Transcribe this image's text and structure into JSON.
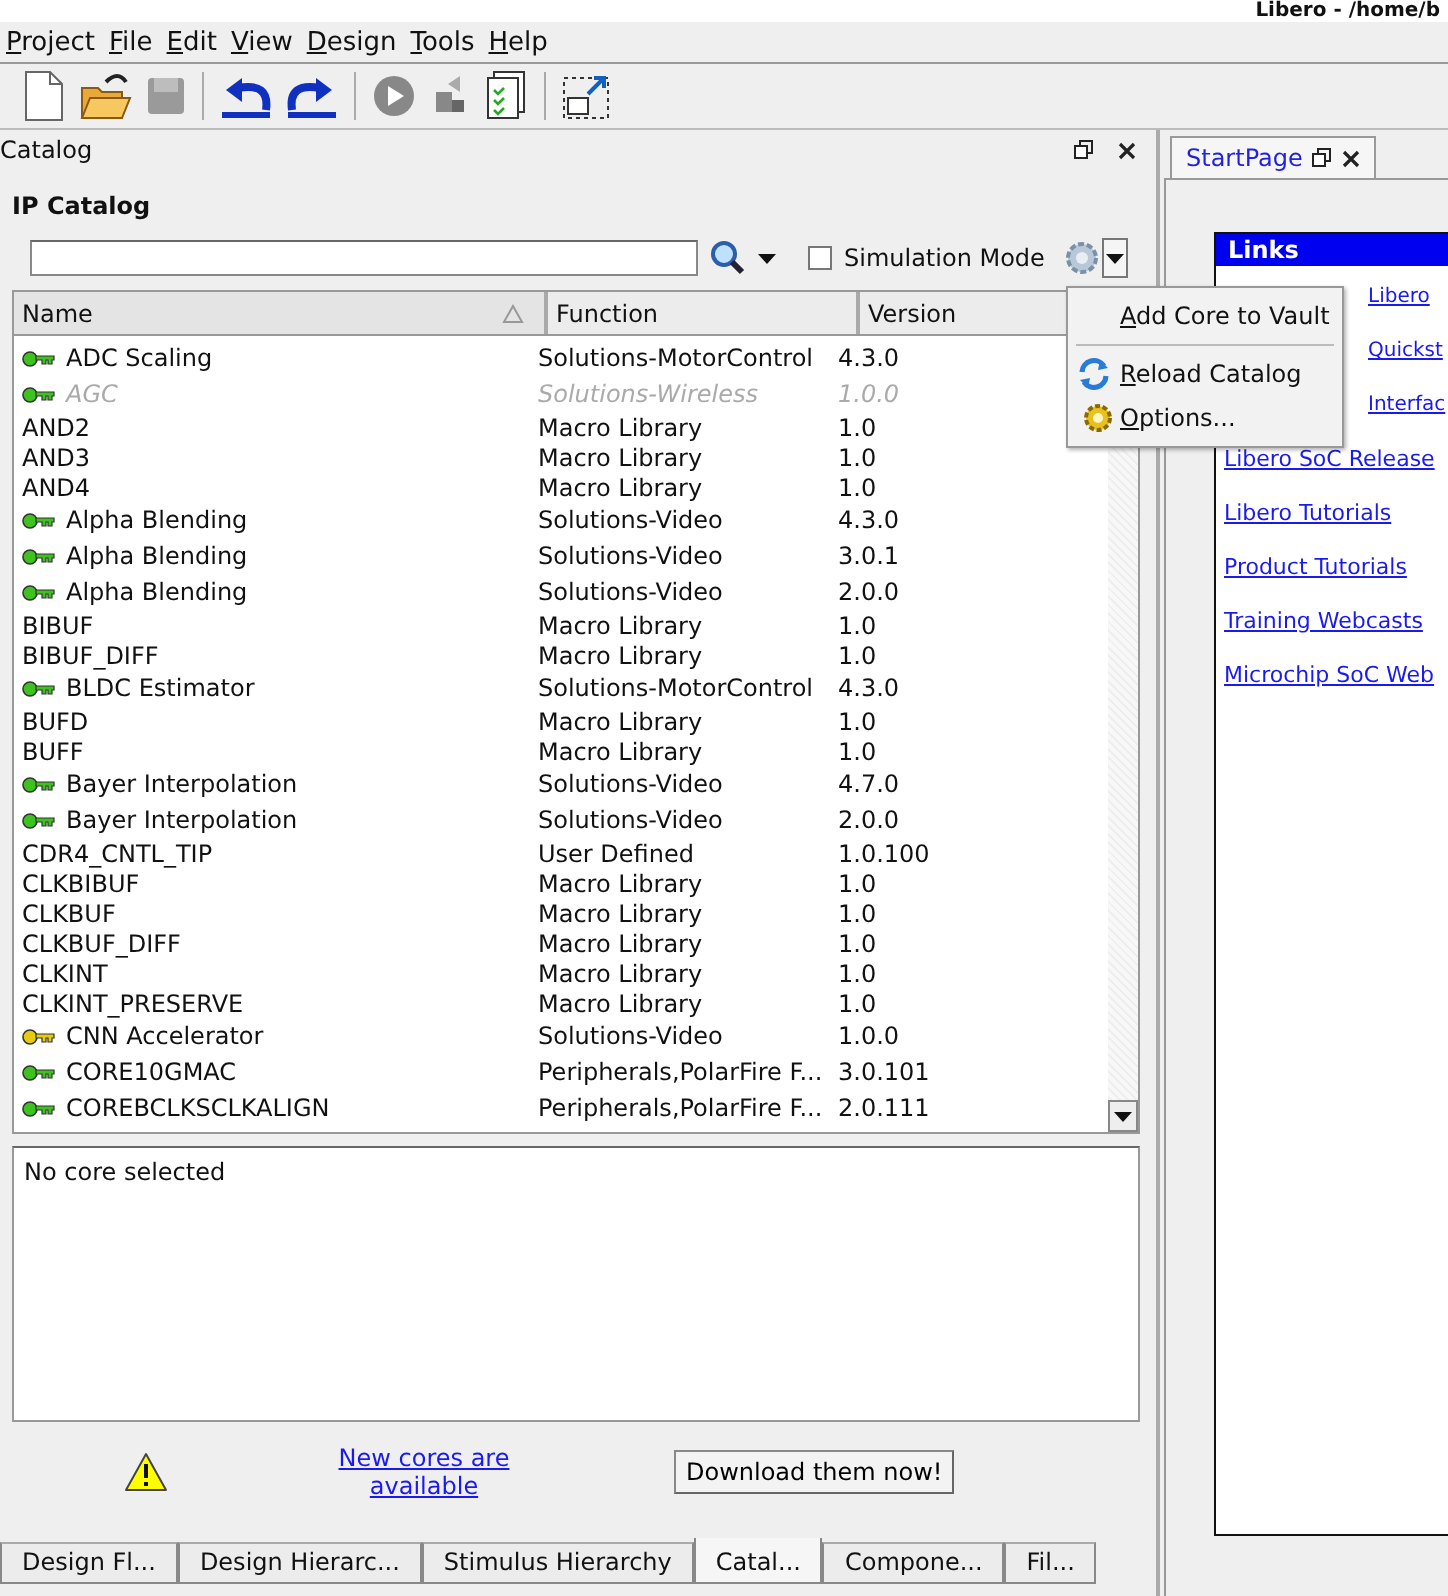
{
  "window": {
    "title": "Libero - /home/b"
  },
  "menubar": [
    "Project",
    "File",
    "Edit",
    "View",
    "Design",
    "Tools",
    "Help"
  ],
  "catalog_panel": {
    "title": "Catalog",
    "heading": "IP Catalog",
    "simulation_mode": {
      "label": "Simulation Mode",
      "checked": false
    },
    "table": {
      "columns": [
        {
          "label": "Name",
          "sorted": true
        },
        {
          "label": "Function",
          "sorted": false
        },
        {
          "label": "Version",
          "sorted": false
        }
      ],
      "rows": [
        {
          "name": "ADC Scaling",
          "function": "Solutions-MotorControl",
          "version": "4.3.0",
          "kind": "licensed",
          "disabled": false
        },
        {
          "name": "AGC",
          "function": "Solutions-Wireless",
          "version": "1.0.0",
          "kind": "licensed",
          "disabled": true
        },
        {
          "name": "AND2",
          "function": "Macro Library",
          "version": "1.0",
          "kind": "plain",
          "disabled": false
        },
        {
          "name": "AND3",
          "function": "Macro Library",
          "version": "1.0",
          "kind": "plain",
          "disabled": false
        },
        {
          "name": "AND4",
          "function": "Macro Library",
          "version": "1.0",
          "kind": "plain",
          "disabled": false
        },
        {
          "name": "Alpha Blending",
          "function": "Solutions-Video",
          "version": "4.3.0",
          "kind": "licensed",
          "disabled": false
        },
        {
          "name": "Alpha Blending",
          "function": "Solutions-Video",
          "version": "3.0.1",
          "kind": "licensed",
          "disabled": false
        },
        {
          "name": "Alpha Blending",
          "function": "Solutions-Video",
          "version": "2.0.0",
          "kind": "licensed",
          "disabled": false
        },
        {
          "name": "BIBUF",
          "function": "Macro Library",
          "version": "1.0",
          "kind": "plain",
          "disabled": false
        },
        {
          "name": "BIBUF_DIFF",
          "function": "Macro Library",
          "version": "1.0",
          "kind": "plain",
          "disabled": false
        },
        {
          "name": "BLDC Estimator",
          "function": "Solutions-MotorControl",
          "version": "4.3.0",
          "kind": "licensed",
          "disabled": false
        },
        {
          "name": "BUFD",
          "function": "Macro Library",
          "version": "1.0",
          "kind": "plain",
          "disabled": false
        },
        {
          "name": "BUFF",
          "function": "Macro Library",
          "version": "1.0",
          "kind": "plain",
          "disabled": false
        },
        {
          "name": "Bayer Interpolation",
          "function": "Solutions-Video",
          "version": "4.7.0",
          "kind": "licensed",
          "disabled": false
        },
        {
          "name": "Bayer Interpolation",
          "function": "Solutions-Video",
          "version": "2.0.0",
          "kind": "licensed",
          "disabled": false
        },
        {
          "name": "CDR4_CNTL_TIP",
          "function": "User Defined",
          "version": "1.0.100",
          "kind": "plain",
          "disabled": false
        },
        {
          "name": "CLKBIBUF",
          "function": "Macro Library",
          "version": "1.0",
          "kind": "plain",
          "disabled": false
        },
        {
          "name": "CLKBUF",
          "function": "Macro Library",
          "version": "1.0",
          "kind": "plain",
          "disabled": false
        },
        {
          "name": "CLKBUF_DIFF",
          "function": "Macro Library",
          "version": "1.0",
          "kind": "plain",
          "disabled": false
        },
        {
          "name": "CLKINT",
          "function": "Macro Library",
          "version": "1.0",
          "kind": "plain",
          "disabled": false
        },
        {
          "name": "CLKINT_PRESERVE",
          "function": "Macro Library",
          "version": "1.0",
          "kind": "plain",
          "disabled": false
        },
        {
          "name": "CNN Accelerator",
          "function": "Solutions-Video",
          "version": "1.0.0",
          "kind": "evaluation",
          "disabled": false
        },
        {
          "name": "CORE10GMAC",
          "function": "Peripherals,PolarFire F...",
          "version": "3.0.101",
          "kind": "licensed",
          "disabled": false
        },
        {
          "name": "COREBCLKSCLKALIGN",
          "function": "Peripherals,PolarFire F...",
          "version": "2.0.111",
          "kind": "licensed",
          "disabled": false
        }
      ]
    },
    "details": "No core selected",
    "notice": {
      "link": "New cores are available",
      "button": "Download them now!"
    },
    "bottom_tabs": [
      {
        "label": "Design Fl...",
        "selected": false
      },
      {
        "label": "Design Hierarc...",
        "selected": false
      },
      {
        "label": "Stimulus Hierarchy",
        "selected": false
      },
      {
        "label": "Catal...",
        "selected": true
      },
      {
        "label": "Compone...",
        "selected": false
      },
      {
        "label": "Fil...",
        "selected": false
      }
    ]
  },
  "gear_menu": [
    "Add Core to Vault",
    "Reload Catalog",
    "Options..."
  ],
  "start_page": {
    "tab": "StartPage",
    "links_heading": "Links",
    "links": [
      "Libero",
      "Quickst",
      "Interfac",
      "Libero SoC Release",
      "Libero Tutorials",
      "Product Tutorials",
      "Training Webcasts",
      "Microchip SoC Web"
    ]
  }
}
